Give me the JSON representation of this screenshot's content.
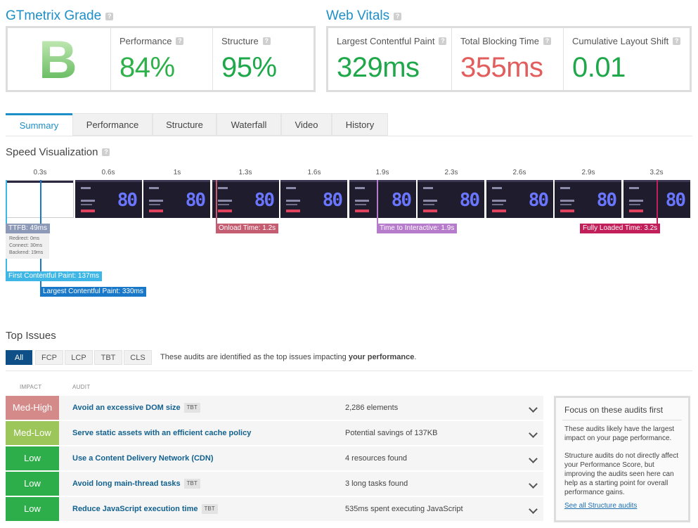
{
  "grade": {
    "title": "GTmetrix Grade",
    "help": "?",
    "letter": "B",
    "performance_label": "Performance",
    "performance_value": "84%",
    "structure_label": "Structure",
    "structure_value": "95%"
  },
  "vitals": {
    "title": "Web Vitals",
    "help": "?",
    "lcp_label": "Largest Contentful Paint",
    "lcp_value": "329ms",
    "tbt_label": "Total Blocking Time",
    "tbt_value": "355ms",
    "cls_label": "Cumulative Layout Shift",
    "cls_value": "0.01"
  },
  "tabs": [
    "Summary",
    "Performance",
    "Structure",
    "Waterfall",
    "Video",
    "History"
  ],
  "speed": {
    "title": "Speed Visualization",
    "ticks": [
      "0.3s",
      "0.6s",
      "1s",
      "1.3s",
      "1.6s",
      "1.9s",
      "2.3s",
      "2.6s",
      "2.9s",
      "3.2s"
    ],
    "frame_value": "80",
    "ttfb": "TTFB: 49ms",
    "redirect": "Redirect: 0ms",
    "connect": "Connect: 30ms",
    "backend": "Backend: 19ms",
    "onload": "Onload Time: 1.2s",
    "tti": "Time to Interactive: 1.9s",
    "fully_loaded": "Fully Loaded Time: 3.2s",
    "fcp": "First Contentful Paint: 137ms",
    "lcp": "Largest Contentful Paint: 330ms"
  },
  "issues": {
    "title": "Top Issues",
    "filters": [
      "All",
      "FCP",
      "LCP",
      "TBT",
      "CLS"
    ],
    "intro_plain": "These audits are identified as the top issues impacting ",
    "intro_bold": "your performance",
    "intro_end": ".",
    "col_impact": "IMPACT",
    "col_audit": "AUDIT",
    "rows": [
      {
        "impact": "Med-High",
        "color": "#d58a8a",
        "audit": "Avoid an excessive DOM size",
        "tag": "TBT",
        "detail": "2,286 elements"
      },
      {
        "impact": "Med-Low",
        "color": "#9cc65a",
        "audit": "Serve static assets with an efficient cache policy",
        "tag": "",
        "detail": "Potential savings of 137KB"
      },
      {
        "impact": "Low",
        "color": "#2eae4a",
        "audit": "Use a Content Delivery Network (CDN)",
        "tag": "",
        "detail": "4 resources found"
      },
      {
        "impact": "Low",
        "color": "#2eae4a",
        "audit": "Avoid long main-thread tasks",
        "tag": "TBT",
        "detail": "3 long tasks found"
      },
      {
        "impact": "Low",
        "color": "#2eae4a",
        "audit": "Reduce JavaScript execution time",
        "tag": "TBT",
        "detail": "535ms spent executing JavaScript"
      }
    ]
  },
  "focus": {
    "title": "Focus on these audits first",
    "p1": "These audits likely have the largest impact on your page performance.",
    "p2": "Structure audits do not directly affect your Performance Score, but improving the audits seen here can help as a starting point for overall performance gains.",
    "link": "See all Structure audits"
  }
}
